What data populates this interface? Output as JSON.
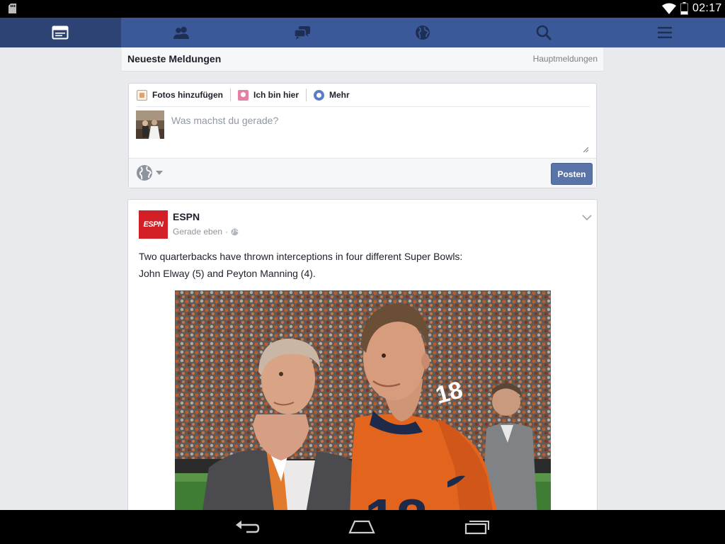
{
  "status_bar": {
    "time": "02:17",
    "icons": [
      "sd-card-icon",
      "wifi-icon",
      "battery-icon"
    ]
  },
  "nav": {
    "tabs": [
      {
        "name": "news-feed",
        "icon": "news-feed-icon",
        "active": true
      },
      {
        "name": "friend-requests",
        "icon": "friends-icon",
        "active": false
      },
      {
        "name": "messages",
        "icon": "messages-icon",
        "active": false
      },
      {
        "name": "notifications",
        "icon": "globe-icon",
        "active": false
      },
      {
        "name": "search",
        "icon": "search-icon",
        "active": false
      },
      {
        "name": "menu",
        "icon": "menu-icon",
        "active": false
      }
    ],
    "colors": {
      "bar": "#3b5998",
      "active": "#2d4373"
    }
  },
  "feed_header": {
    "title": "Neueste Meldungen",
    "top_stories_link": "Hauptmeldungen"
  },
  "composer": {
    "actions": [
      {
        "label": "Fotos hinzufügen",
        "icon": "photo-icon"
      },
      {
        "label": "Ich bin hier",
        "icon": "location-pin-icon"
      },
      {
        "label": "Mehr",
        "icon": "smiley-icon"
      }
    ],
    "placeholder": "Was machst du gerade?",
    "value": "",
    "privacy_icon": "globe-icon",
    "post_button": "Posten",
    "post_button_color": "#5b74a8"
  },
  "story": {
    "page_name": "ESPN",
    "logo_text": "ESPN",
    "logo_color": "#d21f26",
    "timestamp": "Gerade eben",
    "separator": "·",
    "audience_icon": "public-globe-icon",
    "text_line1": "Two quarterbacks have thrown interceptions in four different Super Bowls:",
    "text_line2": "John Elway (5) and Peyton Manning (4).",
    "photo_icon": "photo-two-men-stadium"
  },
  "android_nav": {
    "buttons": [
      "back-icon",
      "home-icon",
      "recent-apps-icon"
    ]
  }
}
